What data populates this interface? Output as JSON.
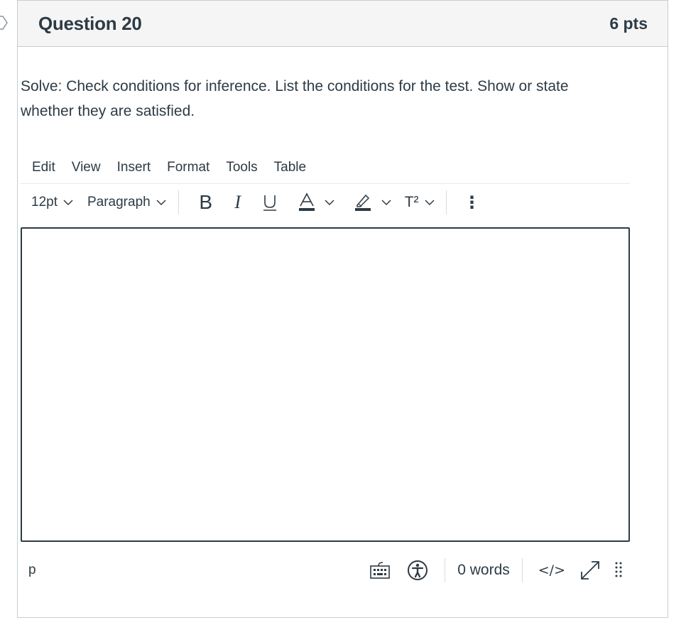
{
  "question": {
    "title": "Question 20",
    "points": "6 pts",
    "text": "Solve: Check conditions for inference. List the conditions for the test. Show or state whether they are satisfied."
  },
  "editor": {
    "menubar": [
      "Edit",
      "View",
      "Insert",
      "Format",
      "Tools",
      "Table"
    ],
    "toolbar": {
      "font_size": "12pt",
      "block_format": "Paragraph",
      "bold_label": "B",
      "italic_label": "I",
      "underline_label": "U",
      "text_color_label": "A",
      "superscript_label": "T²",
      "more_label": "⋮"
    },
    "content": "",
    "status": {
      "path": "p",
      "word_count": "0 words",
      "html_toggle": "</>"
    }
  },
  "icons": {
    "text_color_bar": "#2d3b45",
    "highlight_bar": "#2d3b45"
  }
}
